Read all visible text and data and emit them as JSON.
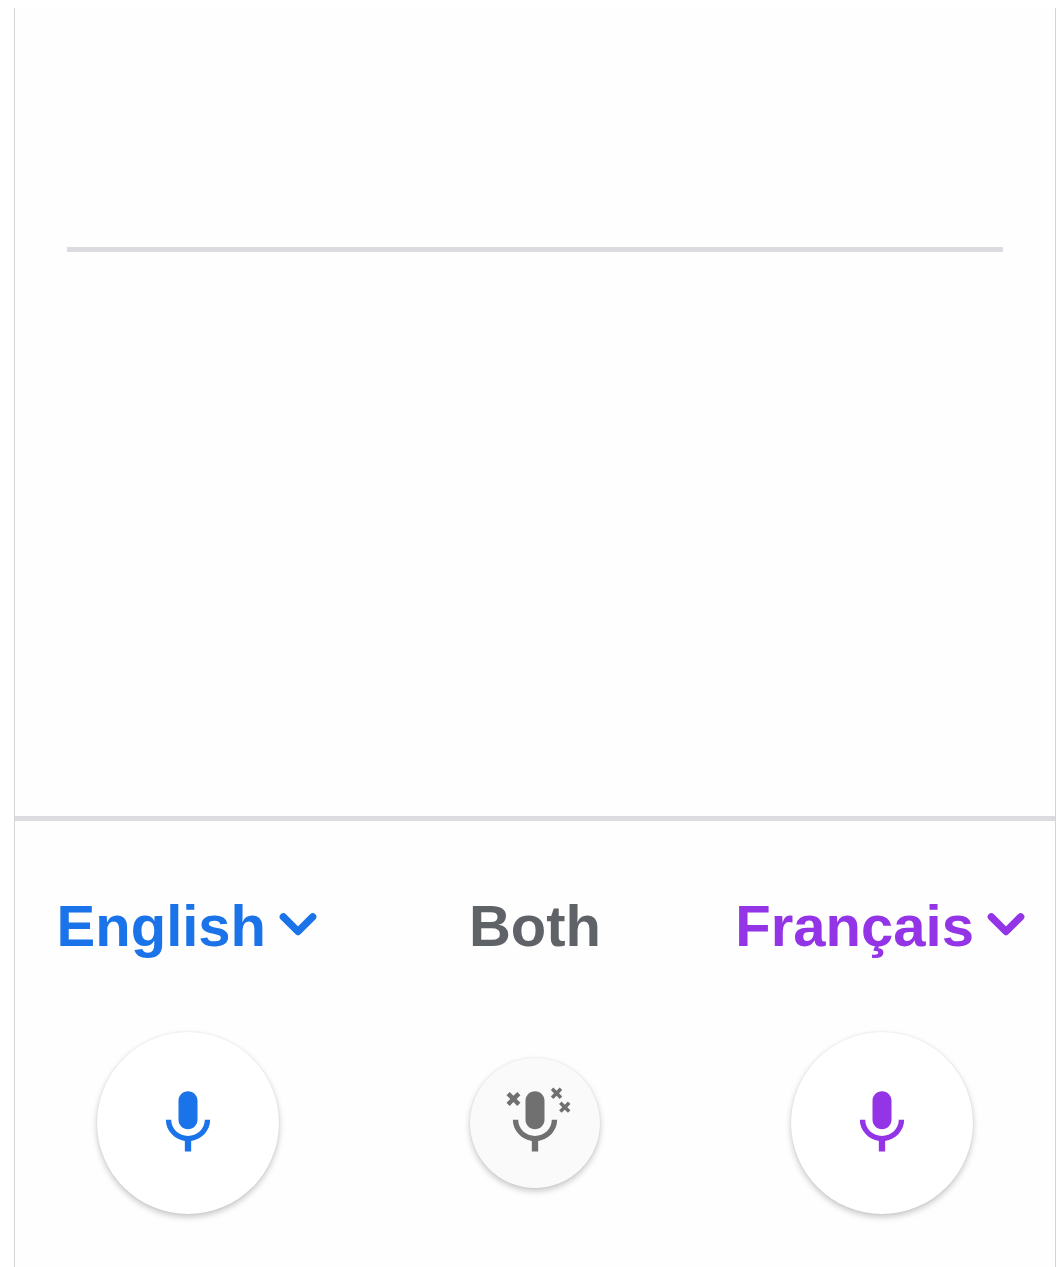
{
  "modes": [
    {
      "kind": "language",
      "label": "English",
      "color": "#1a73e8"
    },
    {
      "kind": "both",
      "label": "Both"
    },
    {
      "kind": "language",
      "label": "Français",
      "color": "#9334e6"
    }
  ]
}
